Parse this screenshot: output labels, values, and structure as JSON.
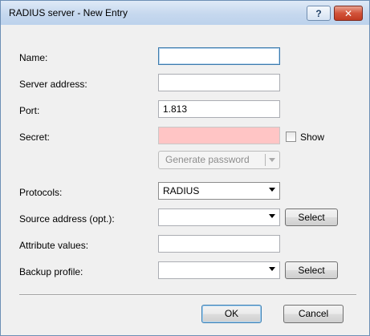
{
  "dialog": {
    "title": "RADIUS server - New Entry",
    "help_label": "?",
    "close_label": "✕"
  },
  "form": {
    "name": {
      "label": "Name:",
      "value": ""
    },
    "server_address": {
      "label": "Server address:",
      "value": ""
    },
    "port": {
      "label": "Port:",
      "value": "1.813"
    },
    "secret": {
      "label": "Secret:",
      "value": "",
      "show_label": "Show",
      "show_checked": false
    },
    "generate_password_label": "Generate password",
    "protocols": {
      "label": "Protocols:",
      "value": "RADIUS"
    },
    "source_address": {
      "label": "Source address (opt.):",
      "value": "",
      "select_label": "Select"
    },
    "attribute_values": {
      "label": "Attribute values:",
      "value": ""
    },
    "backup_profile": {
      "label": "Backup profile:",
      "value": "",
      "select_label": "Select"
    }
  },
  "footer": {
    "ok_label": "OK",
    "cancel_label": "Cancel"
  },
  "colors": {
    "secret_background": "#ffc5c5",
    "title_bar": "#c6d8ee",
    "close_button": "#d2533a"
  }
}
